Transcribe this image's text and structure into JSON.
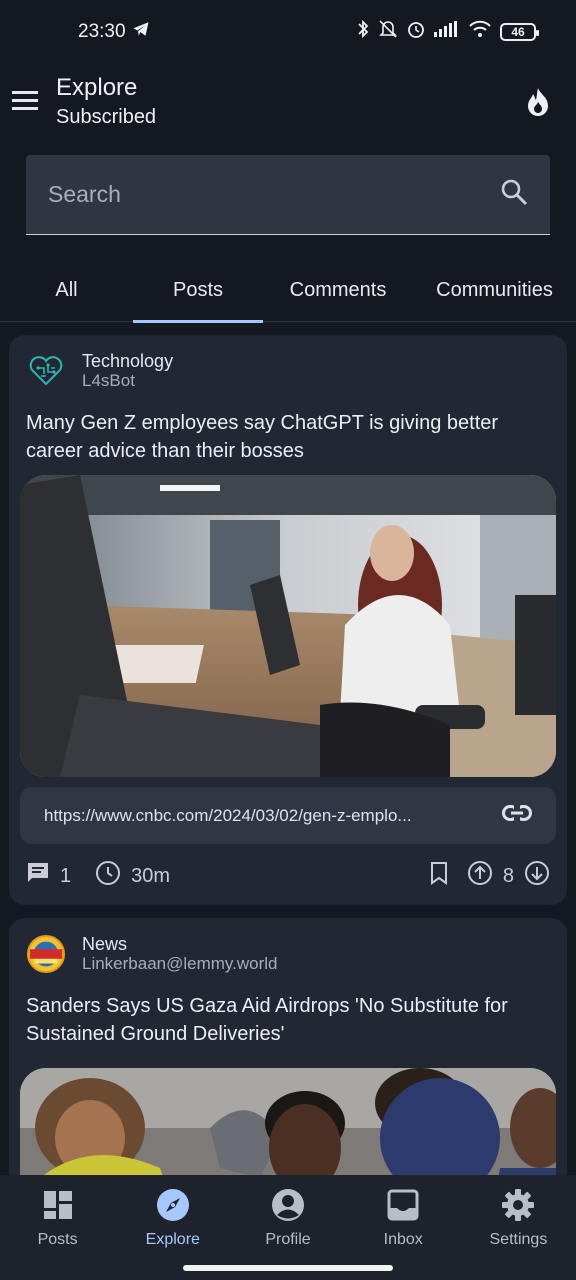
{
  "status": {
    "time": "23:30",
    "battery": "46"
  },
  "app_bar": {
    "title": "Explore",
    "subtitle": "Subscribed"
  },
  "search": {
    "placeholder": "Search"
  },
  "tabs": [
    {
      "label": "All"
    },
    {
      "label": "Posts"
    },
    {
      "label": "Comments"
    },
    {
      "label": "Communities"
    }
  ],
  "posts": [
    {
      "community": "Technology",
      "user": "L4sBot",
      "title": "Many Gen Z employees say ChatGPT is giving better career advice than their bosses",
      "link": "https://www.cnbc.com/2024/03/02/gen-z-emplo...",
      "comments": "1",
      "time": "30m",
      "score": "8"
    },
    {
      "community": "News",
      "user": "Linkerbaan@lemmy.world",
      "title": "Sanders Says US Gaza Aid Airdrops 'No Substitute for Sustained Ground Deliveries'"
    }
  ],
  "nav": [
    {
      "label": "Posts"
    },
    {
      "label": "Explore"
    },
    {
      "label": "Profile"
    },
    {
      "label": "Inbox"
    },
    {
      "label": "Settings"
    }
  ],
  "colors": {
    "background": "#141820",
    "card": "#212733",
    "accent": "#a7c8ff"
  }
}
